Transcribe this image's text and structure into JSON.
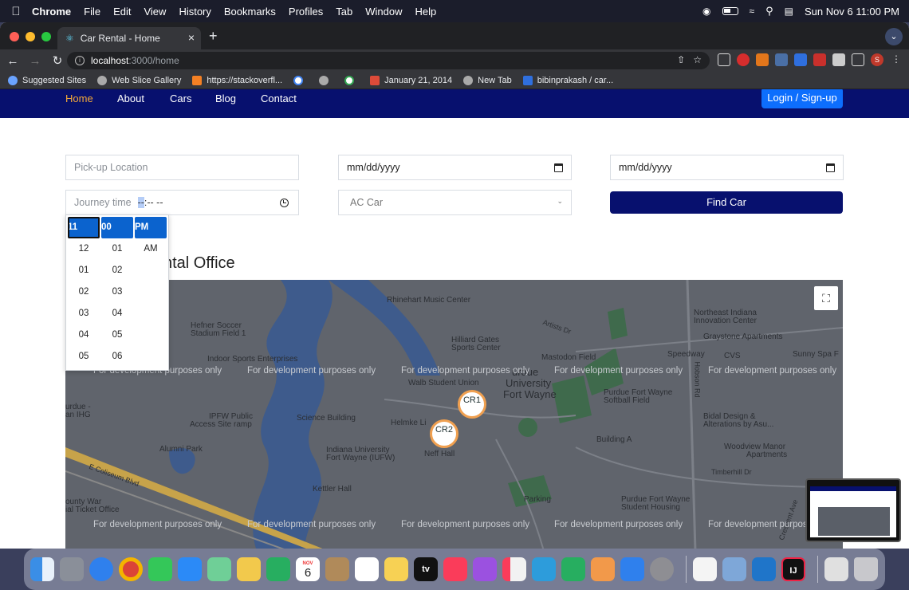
{
  "menubar": {
    "app_name": "Chrome",
    "items": [
      "File",
      "Edit",
      "View",
      "History",
      "Bookmarks",
      "Profiles",
      "Tab",
      "Window",
      "Help"
    ],
    "datetime": "Sun Nov 6  11:00 PM"
  },
  "browser": {
    "tab_title": "Car Rental - Home",
    "url_host": "localhost",
    "url_path": ":3000/home",
    "profile_initial": "S",
    "bookmarks": [
      "Suggested Sites",
      "Web Slice Gallery",
      "https://stackoverfl...",
      "January 21, 2014",
      "New Tab",
      "bibinprakash / car..."
    ]
  },
  "nav": {
    "links": [
      "Home",
      "About",
      "Cars",
      "Blog",
      "Contact"
    ],
    "login_label": "Login / Sign-up"
  },
  "form": {
    "pickup_placeholder": "Pick-up Location",
    "date1": "mm/dd/yyyy",
    "date2": "mm/dd/yyyy",
    "journey_label": "Journey time",
    "journey_hour": "--",
    "journey_rest": ":-- --",
    "car_type": "AC Car",
    "find_label": "Find Car"
  },
  "time_picker": {
    "hours": [
      "11",
      "12",
      "01",
      "02",
      "03",
      "04",
      "05"
    ],
    "minutes": [
      "00",
      "01",
      "02",
      "03",
      "04",
      "05",
      "06"
    ],
    "periods": [
      "PM",
      "AM"
    ]
  },
  "section_title_visible": "ntal Office",
  "map": {
    "watermark": "For development purposes only",
    "markers": [
      "CR1",
      "CR2"
    ],
    "places": {
      "rhinehart": "Rhinehart Music Center",
      "northeast": "Northeast Indiana",
      "innovation": "Innovation Center",
      "graystone": "Graystone Apartments",
      "hefner": "Hefner Soccer",
      "hefner2": "Stadium Field 1",
      "hilliard": "Hilliard Gates",
      "hilliard2": "Sports Center",
      "mastodon": "Mastodon Field",
      "speedway": "Speedway",
      "sunnyspa": "Sunny Spa F",
      "indoor": "Indoor Sports Enterprises",
      "purdue": "urdue",
      "university": "University",
      "fortwayne": "Fort Wayne",
      "walb": "Walb Student Union",
      "pfwsoftball": "Purdue Fort Wayne",
      "pfwsoftball2": "Softball Field",
      "ipfw": "IPFW Public",
      "ipfw2": "Access Site ramp",
      "science": "Science Building",
      "helmke": "Helmke Li",
      "bidal": "Bidal Design &",
      "bidal2": "Alterations by Asu...",
      "alumni": "Alumni Park",
      "building": "Building A",
      "woodview": "Woodview Manor",
      "woodview2": "Apartments",
      "indianauni": "Indiana University",
      "indianauni2": "Fort Wayne (IUFW)",
      "neff": "Neff Hall",
      "coliseum": "E Coliseum Blvd",
      "timberhill": "Timberhill Dr",
      "kettler": "Kettler Hall",
      "parking": "Parking",
      "housing": "Purdue Fort Wayne",
      "housing2": "Student Housing",
      "county": "ounty War",
      "ticket": "ial Ticket Office",
      "purdueihg": "urdue -",
      "purdueihg2": "an IHG",
      "cvs": "CVS",
      "artists": "Artists Dr",
      "hobson": "Hobson Rd",
      "crescent": "Crescent Ave"
    }
  },
  "dock": {
    "calendar_month": "NOV",
    "calendar_day": "6",
    "tv_label": "tv",
    "ide_label": "IJ"
  }
}
